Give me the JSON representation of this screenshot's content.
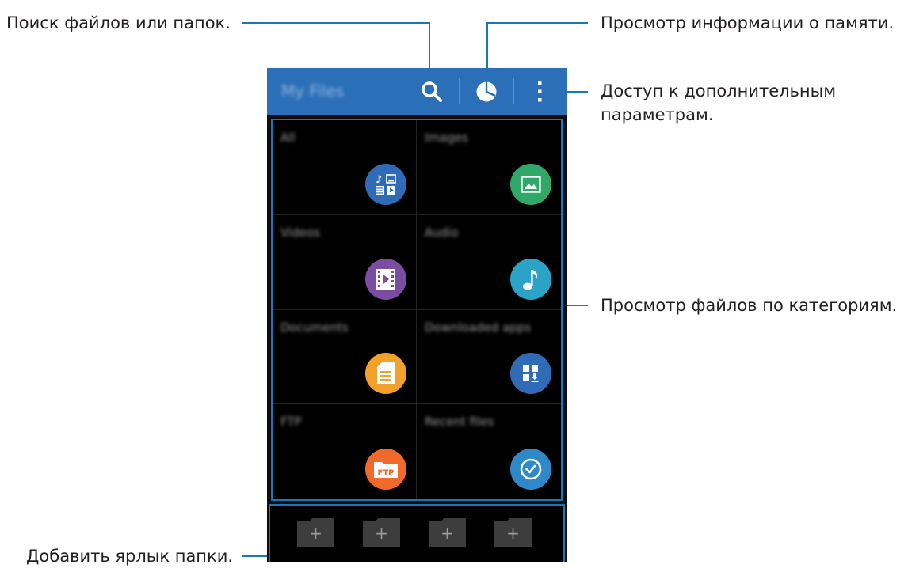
{
  "callouts": {
    "search": "Поиск файлов или папок.",
    "storage": "Просмотр информации о памяти.",
    "more_line1": "Доступ к дополнительным",
    "more_line2": "параметрам.",
    "categories": "Просмотр файлов по категориям.",
    "shortcut": "Добавить ярлык папки."
  },
  "appbar": {
    "title": "My Files",
    "icons": [
      "search-icon",
      "storage-pie-icon",
      "more-options-icon"
    ]
  },
  "categories": [
    {
      "label": "All",
      "icon": "all-files-icon",
      "color": "#2f6bb6"
    },
    {
      "label": "Images",
      "icon": "image-icon",
      "color": "#2fa86a"
    },
    {
      "label": "Videos",
      "icon": "video-icon",
      "color": "#7a4da3"
    },
    {
      "label": "Audio",
      "icon": "music-note-icon",
      "color": "#2aa3c7"
    },
    {
      "label": "Documents",
      "icon": "document-icon",
      "color": "#f2a22a"
    },
    {
      "label": "Downloaded apps",
      "icon": "download-apps-icon",
      "color": "#2f6bb6"
    },
    {
      "label": "FTP",
      "icon": "ftp-folder-icon",
      "color": "#f06a2b",
      "badge": "FTP"
    },
    {
      "label": "Recent files",
      "icon": "clock-icon",
      "color": "#2f89c8"
    }
  ],
  "shortcuts": {
    "count": 4,
    "plus": "+"
  },
  "colors": {
    "accent": "#1b75bb",
    "appbar": "#2b6fb8"
  }
}
